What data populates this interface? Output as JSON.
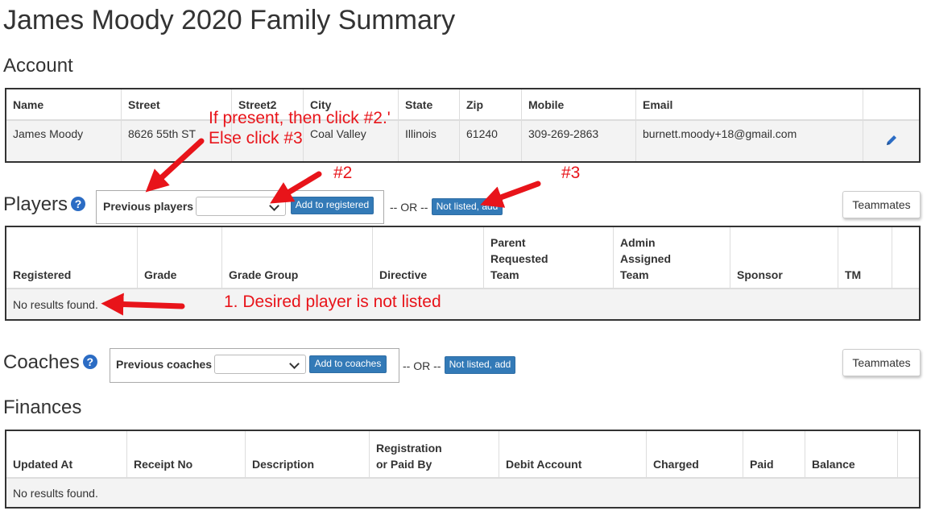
{
  "page": {
    "title": "James Moody 2020 Family Summary"
  },
  "account": {
    "section_title": "Account",
    "columns": [
      "Name",
      "Street",
      "Street2",
      "City",
      "State",
      "Zip",
      "Mobile",
      "Email",
      ""
    ],
    "row": {
      "name": "James Moody",
      "street": "8626 55th ST",
      "street2": "",
      "city": "Coal Valley",
      "state": "Illinois",
      "zip": "61240",
      "mobile": "309-269-2863",
      "email": "burnett.moody+18@gmail.com"
    },
    "edit_icon": "pencil-icon"
  },
  "players": {
    "section_title": "Players",
    "help_icon": "question-circle-icon",
    "previous_label": "Previous players",
    "select_value": "",
    "add_button": "Add to registered",
    "or_text": "-- OR --",
    "not_listed_button": "Not listed, add",
    "teammates_button": "Teammates",
    "columns": [
      "Registered",
      "Grade",
      "Grade Group",
      "Directive",
      "Parent\nRequested\nTeam",
      "Admin\nAssigned\nTeam",
      "Sponsor",
      "TM",
      ""
    ],
    "empty_text": "No results found."
  },
  "coaches": {
    "section_title": "Coaches",
    "help_icon": "question-circle-icon",
    "previous_label": "Previous coaches",
    "select_value": "",
    "add_button": "Add to coaches",
    "or_text": "-- OR --",
    "not_listed_button": "Not listed, add",
    "teammates_button": "Teammates"
  },
  "finances": {
    "section_title": "Finances",
    "columns": [
      "Updated At",
      "Receipt No",
      "Description",
      "Registration\nor Paid By",
      "Debit Account",
      "Charged",
      "Paid",
      "Balance",
      ""
    ],
    "empty_text": "No results found."
  },
  "annotations": {
    "instruction_line1": "If present, then click #2.'",
    "instruction_line2": "Else click #3",
    "step2": "#2",
    "step3": "#3",
    "step1": "1. Desired player is not listed",
    "color": "#e8141a"
  },
  "colors": {
    "primary_button": "#337ab7",
    "help_icon": "#2b6cc4",
    "annotation": "#e8141a"
  }
}
